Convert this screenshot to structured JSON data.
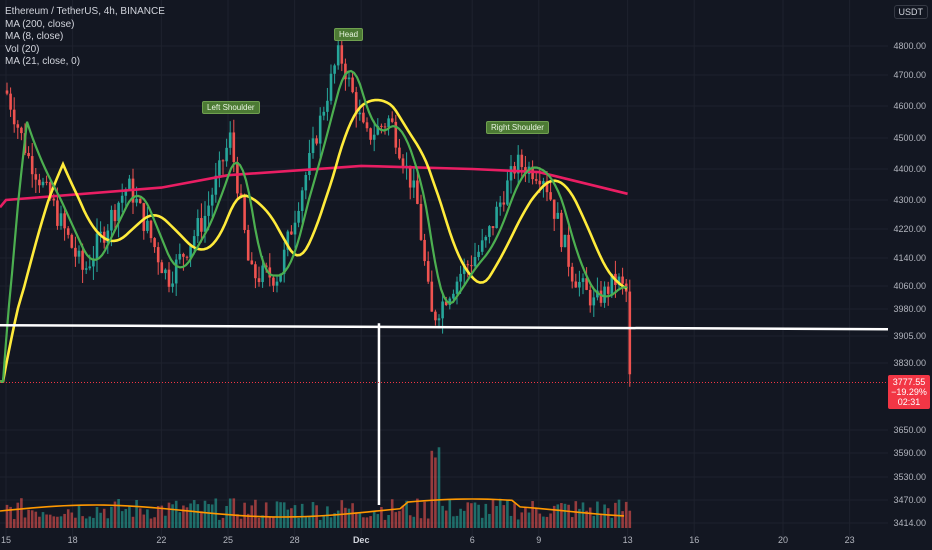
{
  "header": {
    "symbol_line": "Ethereum / TetherUS, 4h, BINANCE",
    "indicators": [
      "MA (200, close)",
      "MA (8, close)",
      "Vol (20)",
      "MA (21, close, 0)"
    ],
    "currency": "USDT"
  },
  "price_tag": {
    "price": "3777.55",
    "change": "−19.29%",
    "countdown": "02:31"
  },
  "annotations": {
    "left_shoulder": "Left Shoulder",
    "head": "Head",
    "right_shoulder": "Right Shoulder"
  },
  "colors": {
    "background": "#131722",
    "up": "#26a69a",
    "down": "#ef5350",
    "ma200": "#e91e63",
    "ma8": "#4caf50",
    "ma21": "#ffeb3b",
    "vol_ma": "#ff9800",
    "pattern_fill": "#4caf50",
    "neckline": "#ffffff"
  },
  "chart_data": {
    "type": "candlestick",
    "title": "Ethereum / TetherUS, 4h, BINANCE",
    "y_axis_ticks": [
      "4800.00",
      "4700.00",
      "4600.00",
      "4500.00",
      "4400.00",
      "4300.00",
      "4220.00",
      "4140.00",
      "4060.00",
      "3980.00",
      "3905.00",
      "3830.00",
      "3650.00",
      "3590.00",
      "3530.00",
      "3470.00",
      "3414.00"
    ],
    "x_axis_ticks": [
      "15",
      "18",
      "22",
      "25",
      "28",
      "Dec",
      "6",
      "9",
      "13",
      "16",
      "20",
      "23"
    ],
    "last_price": 3777.55,
    "pattern": "head and shoulders",
    "neckline_price": 3935,
    "key_points": [
      {
        "label": "start",
        "date": "Nov 15",
        "price": 3930
      },
      {
        "label": "Left Shoulder",
        "date": "Nov 25",
        "price": 4560
      },
      {
        "label": "Head",
        "date": "Nov 30",
        "price": 4820
      },
      {
        "label": "Right Shoulder",
        "date": "Dec 8",
        "price": 4470
      },
      {
        "label": "end",
        "date": "Dec 13",
        "price": 3940
      }
    ],
    "ma_200_approx": [
      {
        "date": "Nov 15",
        "price": 4300
      },
      {
        "date": "Nov 22",
        "price": 4340
      },
      {
        "date": "Nov 25",
        "price": 4380
      },
      {
        "date": "Dec 1",
        "price": 4410
      },
      {
        "date": "Dec 6",
        "price": 4400
      },
      {
        "date": "Dec 9",
        "price": 4390
      },
      {
        "date": "Dec 13",
        "price": 4320
      }
    ],
    "grid": true,
    "legend_position": "top-left"
  }
}
